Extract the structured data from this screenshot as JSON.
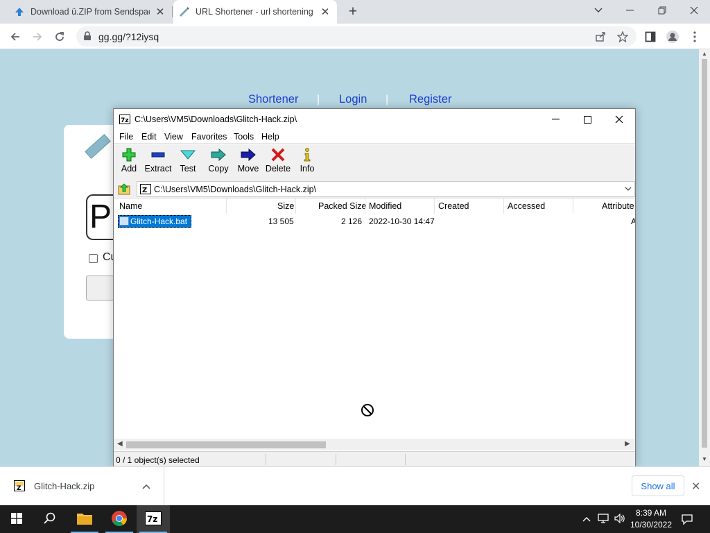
{
  "browser": {
    "tabs": [
      {
        "title": "Download ü.ZIP from Sendspace"
      },
      {
        "title": "URL Shortener - url shortening s"
      }
    ],
    "url": "gg.gg/?12iysq"
  },
  "page": {
    "nav": [
      "Shortener",
      "Login",
      "Register"
    ],
    "big_letter": "P",
    "checkbox_label": "Cu"
  },
  "sevenzip": {
    "title": "C:\\Users\\VM5\\Downloads\\Glitch-Hack.zip\\",
    "menu": [
      "File",
      "Edit",
      "View",
      "Favorites",
      "Tools",
      "Help"
    ],
    "toolbar": [
      "Add",
      "Extract",
      "Test",
      "Copy",
      "Move",
      "Delete",
      "Info"
    ],
    "address": "C:\\Users\\VM5\\Downloads\\Glitch-Hack.zip\\",
    "columns": [
      "Name",
      "Size",
      "Packed Size",
      "Modified",
      "Created",
      "Accessed",
      "Attribute"
    ],
    "files": [
      {
        "name": "Glitch-Hack.bat",
        "size": "13 505",
        "packed": "2 126",
        "modified": "2022-10-30 14:47",
        "attr": "A"
      }
    ],
    "status": "0 / 1 object(s) selected"
  },
  "downloads": {
    "file": "Glitch-Hack.zip",
    "show_all": "Show all"
  },
  "taskbar": {
    "time": "8:39 AM",
    "date": "10/30/2022"
  },
  "colors": {
    "page_bg": "#b7d7e3",
    "link": "#1a3fcf",
    "selection": "#0078d7",
    "taskbar": "#1c1c1c"
  }
}
